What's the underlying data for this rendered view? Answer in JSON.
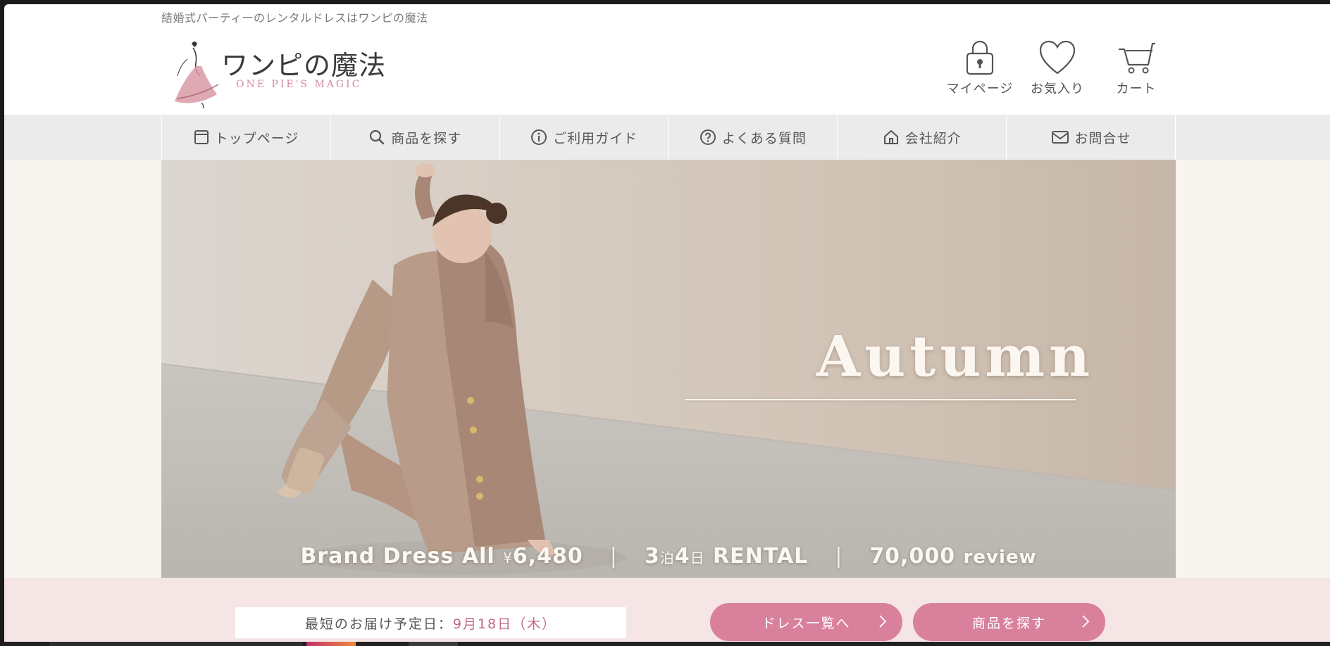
{
  "header": {
    "tagline": "結婚式パーティーのレンタルドレスはワンピの魔法",
    "logo_jp": "ワンピの魔法",
    "logo_en": "ONE PIE'S MAGIC",
    "icons": [
      {
        "label": "マイページ",
        "icon": "lock-icon"
      },
      {
        "label": "お気入り",
        "icon": "heart-icon"
      },
      {
        "label": "カート",
        "icon": "cart-icon"
      }
    ]
  },
  "nav": {
    "items": [
      {
        "label": "トップページ",
        "icon": "browser-window-icon"
      },
      {
        "label": "商品を探す",
        "icon": "search-icon"
      },
      {
        "label": "ご利用ガイド",
        "icon": "info-icon"
      },
      {
        "label": "よくある質問",
        "icon": "question-icon"
      },
      {
        "label": "会社紹介",
        "icon": "home-icon"
      },
      {
        "label": "お問合せ",
        "icon": "mail-icon"
      }
    ]
  },
  "hero": {
    "headline": "Autumn",
    "promo": {
      "part1": "Brand Dress All",
      "yen": "¥",
      "price": "6,480",
      "nights": "3",
      "nights_unit": "泊",
      "days": "4",
      "days_unit": "日",
      "rental": "RENTAL",
      "reviews": "70,000",
      "reviews_label": "review",
      "separator": "|"
    }
  },
  "bottom": {
    "delivery_label": "最短のお届け予定日：",
    "delivery_date": "9月18日（木）",
    "buttons": [
      {
        "label": "ドレス一覧へ"
      },
      {
        "label": "商品を探す"
      }
    ]
  },
  "colors": {
    "accent_pink": "#d9819c",
    "date_pink": "#c4687f",
    "nav_bg": "#ebebeb",
    "bottom_bg": "#f5e5e4"
  }
}
